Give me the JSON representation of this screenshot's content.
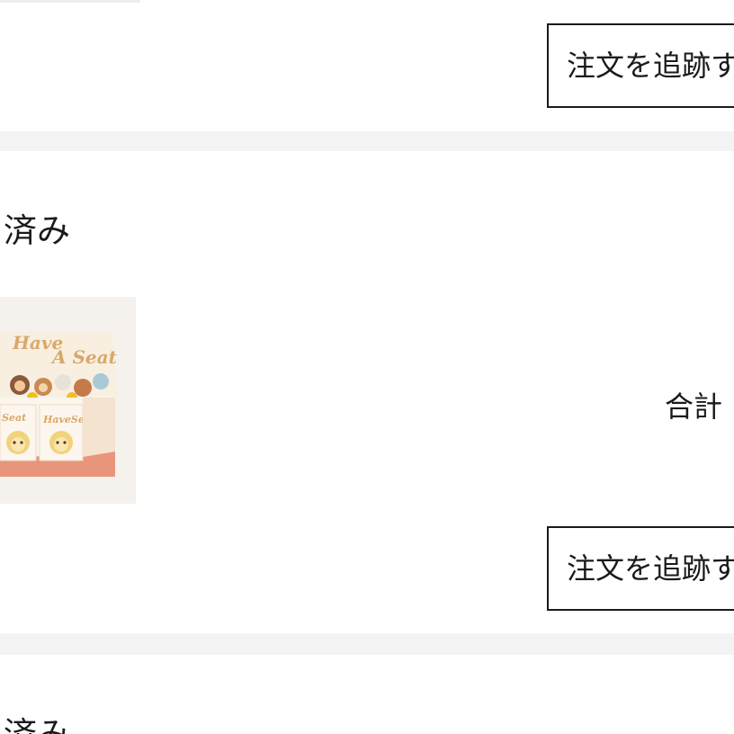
{
  "orders": [
    {
      "track_button_label": "注文を追跡す"
    },
    {
      "status": "済み",
      "product_image_alt": "Have A Seat",
      "total_label": "合計",
      "track_button_label": "注文を追跡す"
    },
    {
      "status": "済み"
    }
  ],
  "colors": {
    "page_background": "#ffffff",
    "separator": "#f3f3f3",
    "text": "#1a1a1a",
    "button_border": "#1a1a1a",
    "box_peach": "#e8957c",
    "box_cream": "#f7ead6"
  }
}
